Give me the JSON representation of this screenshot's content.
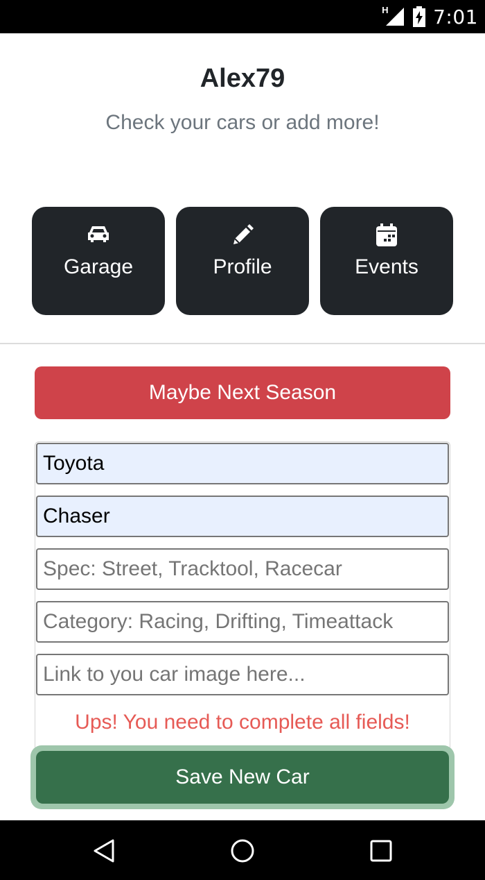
{
  "status_bar": {
    "time": "7:01",
    "network_label": "H"
  },
  "header": {
    "username": "Alex79",
    "tagline": "Check your cars or add more!"
  },
  "nav": [
    {
      "label": "Garage",
      "icon": "car-icon"
    },
    {
      "label": "Profile",
      "icon": "pencil-icon"
    },
    {
      "label": "Events",
      "icon": "calendar-icon"
    }
  ],
  "cancel_button": {
    "label": "Maybe Next Season",
    "color": "#cf434a"
  },
  "form": {
    "make": {
      "value": "Toyota"
    },
    "model": {
      "value": "Chaser"
    },
    "spec": {
      "placeholder": "Spec: Street, Tracktool, Racecar"
    },
    "category": {
      "placeholder": "Category: Racing, Drifting, Timeattack"
    },
    "image_link": {
      "placeholder": "Link to you car image here..."
    },
    "error": "Ups! You need to complete all fields!",
    "save_label": "Save New Car"
  },
  "colors": {
    "dark": "#212529",
    "save": "#36704b",
    "error": "#e65a55"
  },
  "system_nav": {
    "back": "back-icon",
    "home": "home-icon",
    "recents": "recents-icon"
  }
}
